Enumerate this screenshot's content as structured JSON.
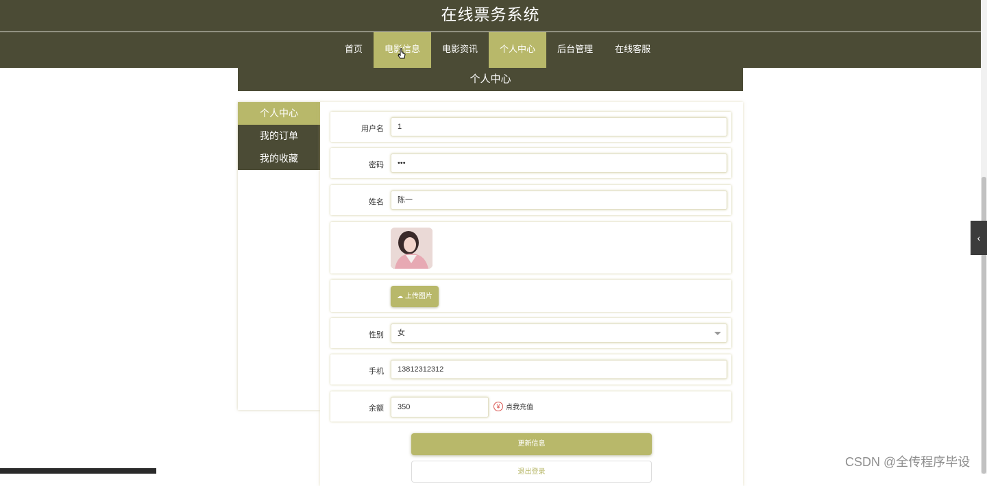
{
  "header": {
    "title": "在线票务系统"
  },
  "nav": {
    "items": [
      {
        "label": "首页",
        "active": false
      },
      {
        "label": "电影信息",
        "active": true
      },
      {
        "label": "电影资讯",
        "active": false
      },
      {
        "label": "个人中心",
        "active": true
      },
      {
        "label": "后台管理",
        "active": false
      },
      {
        "label": "在线客服",
        "active": false
      }
    ]
  },
  "banner": {
    "title": "个人中心"
  },
  "sidebar": {
    "items": [
      {
        "label": "个人中心",
        "active": true
      },
      {
        "label": "我的订单",
        "active": false
      },
      {
        "label": "我的收藏",
        "active": false
      }
    ]
  },
  "form": {
    "username": {
      "label": "用户名",
      "value": "1"
    },
    "password": {
      "label": "密码",
      "value": "•••"
    },
    "name": {
      "label": "姓名",
      "value": "陈一"
    },
    "upload_label": "上传图片",
    "gender": {
      "label": "性别",
      "value": "女"
    },
    "phone": {
      "label": "手机",
      "value": "13812312312"
    },
    "balance": {
      "label": "余额",
      "value": "350"
    },
    "recharge_label": "点我充值",
    "update_label": "更新信息",
    "logout_label": "退出登录"
  },
  "watermark": "CSDN @全传程序毕设",
  "colors": {
    "dark": "#4b4b35",
    "accent": "#b8b86a"
  }
}
